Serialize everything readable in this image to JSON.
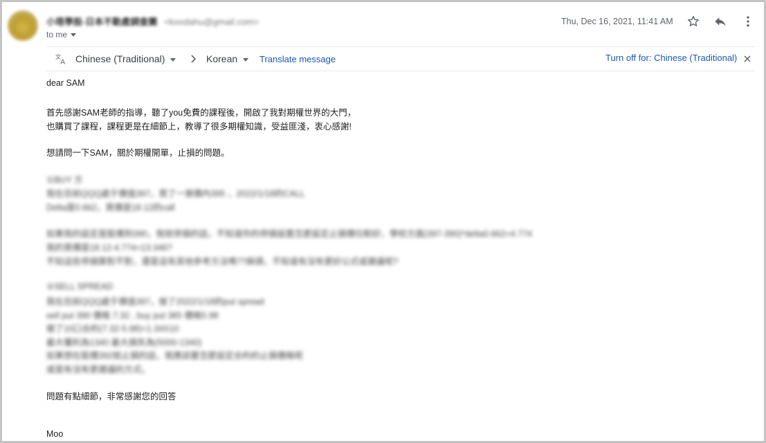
{
  "header": {
    "sender_name": "小塔學股-日本不動產調查團",
    "sender_email": "<koodahu@gmail.com>",
    "to_label": "to me",
    "date": "Thu, Dec 16, 2021, 11:41 AM"
  },
  "icons": {
    "avatar": "avatar",
    "star": "star-icon",
    "reply": "reply-icon",
    "more": "more-vert-icon",
    "translate": "translate-icon",
    "close": "close-icon",
    "arrow": "chevron-right-icon"
  },
  "translate_bar": {
    "from_lang": "Chinese (Traditional)",
    "to_lang": "Korean",
    "translate_link": "Translate message",
    "turn_off": "Turn off for: Chinese (Traditional)"
  },
  "message": {
    "greeting": "dear SAM",
    "p1_l1": "首先感謝SAM老師的指導，聽了you免費的課程後，開啟了我對期權世界的大門，",
    "p1_l2": "也購買了課程，課程更是在細節上，教導了很多期權知識，受益匪淺，衷心感謝!",
    "p2": "想請問一下SAM，關於期權開單，止損的問題。",
    "q1_title": "①BUY 方",
    "q1_l1": "我在目前QQQ處于價值397，買了一張價內395 ，2022/1/18的CALL",
    "q1_l2": "Delta是0.662，買價是18.12的call",
    "q1_l3": "如果我的設定是股價到390，我就停損的話，不知道你的停損設置怎麼設定止損價位較好，學校方面(397-390)*delta0.662=4.774",
    "q1_l4": "我的買價是18.12-4.774=13.346?",
    "q1_l5": "不知這些停損算對不對，還是這有其他參考方法嗎??麻煩，不知道有沒有更好公式或建議呢?",
    "q2_title": "②SELL SPREAD",
    "q2_l1": "我在目前QQQ處于價值397，做了2022/1/18的put spread",
    "q2_l2": "sell put 390 價格 7.32 , buy put 385 價格5.98",
    "q2_l3": "做了10口合約(7.32-5.98)=1.34X10",
    "q2_l4": "最大獲利為1340 最大損失為(5000-1340)",
    "q2_l5": "如果想在股價392就止損的話，我應該要怎麼設定合約的止損價格呢",
    "q2_l6": "或是有沒有更建議的方式。",
    "closing": "問題有點細節，非常感謝您的回答",
    "signature": "Moo"
  }
}
